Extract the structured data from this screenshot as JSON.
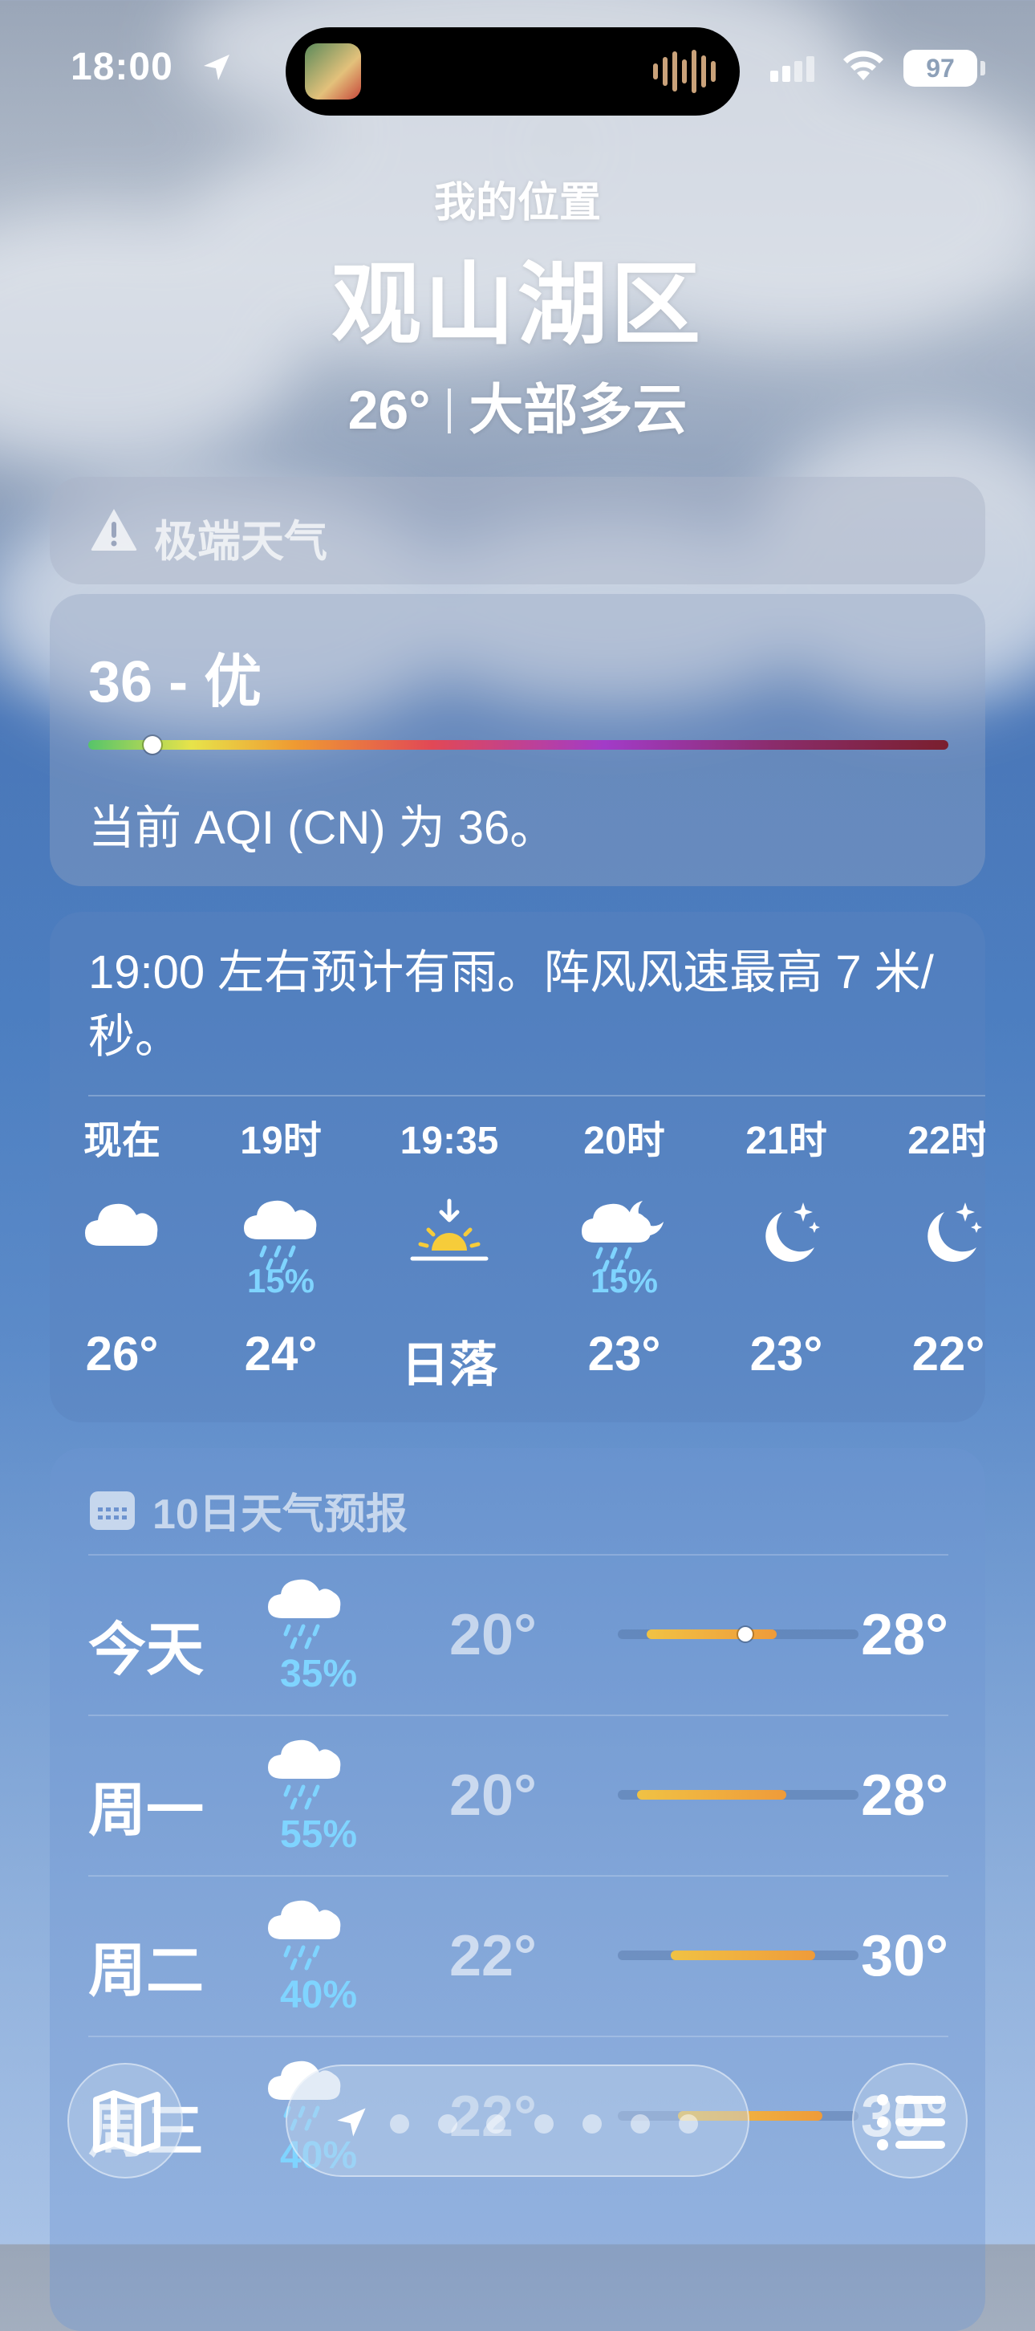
{
  "status_bar": {
    "time": "18:00",
    "battery": "97"
  },
  "header": {
    "my_location": "我的位置",
    "city": "观山湖区",
    "temp": "26°",
    "condition": "大部多云"
  },
  "alert": {
    "label": "极端天气"
  },
  "aqi": {
    "value_label": "36 - 优",
    "position_fraction": 0.075,
    "description": "当前 AQI (CN) 为 36。"
  },
  "hourly": {
    "summary": "19:00 左右预计有雨。阵风风速最高 7 米/秒。",
    "items": [
      {
        "time": "现在",
        "icon": "cloud-icon",
        "precip": "",
        "temp": "26°"
      },
      {
        "time": "19时",
        "icon": "cloud-rain-icon",
        "precip": "15%",
        "temp": "24°"
      },
      {
        "time": "19:35",
        "icon": "sunset-icon",
        "precip": "",
        "temp": "日落"
      },
      {
        "time": "20时",
        "icon": "cloud-moon-rain-icon",
        "precip": "15%",
        "temp": "23°"
      },
      {
        "time": "21时",
        "icon": "moon-stars-icon",
        "precip": "",
        "temp": "23°"
      },
      {
        "time": "22时",
        "icon": "moon-stars-icon",
        "precip": "",
        "temp": "22°"
      }
    ]
  },
  "daily": {
    "title": "10日天气预报",
    "rows": [
      {
        "day": "今天",
        "icon": "cloud-rain-icon",
        "precip": "35%",
        "low": "20°",
        "high": "28°",
        "range": [
          0.12,
          0.66
        ],
        "current": 0.53
      },
      {
        "day": "周一",
        "icon": "cloud-rain-icon",
        "precip": "55%",
        "low": "20°",
        "high": "28°",
        "range": [
          0.08,
          0.7
        ]
      },
      {
        "day": "周二",
        "icon": "cloud-rain-icon",
        "precip": "40%",
        "low": "22°",
        "high": "30°",
        "range": [
          0.22,
          0.82
        ]
      },
      {
        "day": "周三",
        "icon": "cloud-rain-icon",
        "precip": "40%",
        "low": "22°",
        "high": "30°",
        "range": [
          0.25,
          0.85
        ]
      }
    ]
  },
  "colors": {
    "precip": "#7fd4ff",
    "temp_bar_start": "#f0c244",
    "temp_bar_end": "#ef9b3a"
  }
}
